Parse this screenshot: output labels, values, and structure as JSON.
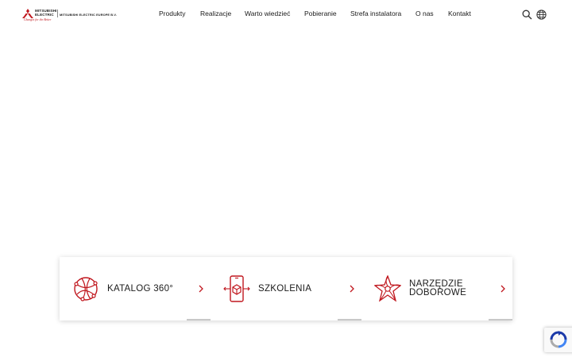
{
  "brand": {
    "line1": "MITSUBISHI",
    "line2": "ELECTRIC",
    "tagline": "Changes for the Better",
    "company": "MITSUBISHI ELECTRIC EUROPE B.V.",
    "accent_color": "#c0171e"
  },
  "nav": {
    "items": [
      {
        "label": "Produkty"
      },
      {
        "label": "Realizacje"
      },
      {
        "label": "Warto wiedzieć"
      },
      {
        "label": "Pobieranie"
      },
      {
        "label": "Strefa instalatora"
      },
      {
        "label": "O nas"
      },
      {
        "label": "Kontakt"
      }
    ]
  },
  "header_icons": {
    "search": "search-icon",
    "language": "globe-icon"
  },
  "cards": [
    {
      "line1": "KATALOG 360°",
      "line2": "",
      "icon": "globe-network-icon"
    },
    {
      "line1": "SZKOLENIA",
      "line2": "",
      "icon": "phone-cube-icon"
    },
    {
      "line1": "NARZĘDZIE",
      "line2": "DOBOROWE",
      "icon": "fan-star-icon"
    }
  ],
  "recaptcha": {
    "icon": "recaptcha-icon"
  }
}
